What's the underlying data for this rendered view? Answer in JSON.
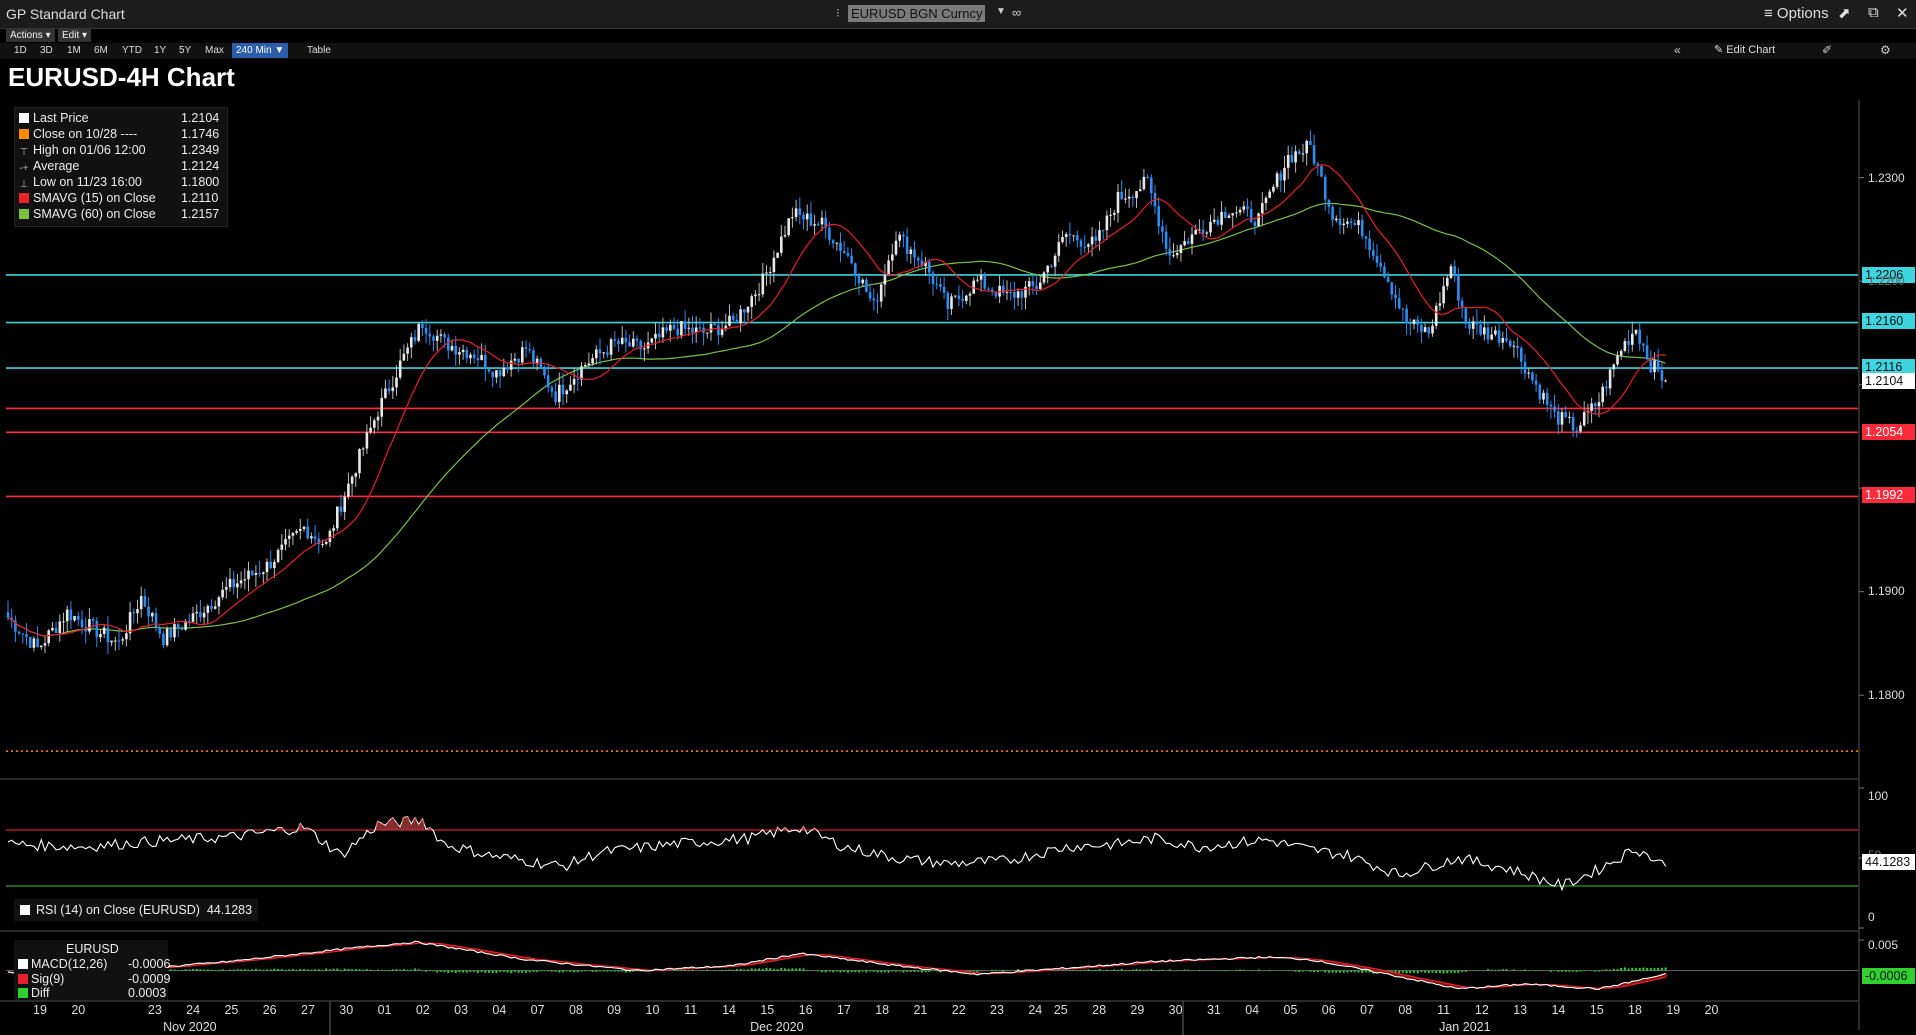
{
  "window": {
    "app_title": "GP Standard Chart",
    "ticker": "EURUSD BGN Curncy",
    "options_label": "Options"
  },
  "toolbar": {
    "actions_label": "Actions ▾",
    "edit_label": "Edit ▾",
    "ranges": [
      "1D",
      "3D",
      "1M",
      "6M",
      "YTD",
      "1Y",
      "5Y",
      "Max"
    ],
    "interval_label": "240 Min ▼",
    "table_label": "Table",
    "edit_chart_label": "Edit Chart"
  },
  "chart_data": {
    "type": "candlestick",
    "title": "EURUSD-4H Chart",
    "legend": [
      {
        "label": "Last Price",
        "value": "1.2104",
        "color": "#ffffff"
      },
      {
        "label": "Close on 10/28 ----",
        "value": "1.1746",
        "color": "#ff8c00"
      },
      {
        "label": "High on 01/06 12:00",
        "value": "1.2349",
        "color": "#aaaaaa"
      },
      {
        "label": "Average",
        "value": "1.2124",
        "color": "#aaaaaa"
      },
      {
        "label": "Low on 11/23 16:00",
        "value": "1.1800",
        "color": "#aaaaaa"
      },
      {
        "label": "SMAVG (15)  on Close",
        "value": "1.2110",
        "color": "#e8202a"
      },
      {
        "label": "SMAVG (60)  on Close",
        "value": "1.2157",
        "color": "#7ac143"
      }
    ],
    "ylim": [
      1.172,
      1.2375
    ],
    "y_ticks": [
      "1.2300",
      "1.2200",
      "1.2100",
      "1.2000",
      "1.1900",
      "1.1800"
    ],
    "last_price_tag": "1.2104",
    "resistance_lines": [
      {
        "value": 1.2206,
        "label": "1.2206",
        "color": "#3dd6e0"
      },
      {
        "value": 1.216,
        "label": "1.2160",
        "color": "#3dd6e0"
      },
      {
        "value": 1.2116,
        "label": "1.2116",
        "color": "#3dd6e0"
      }
    ],
    "support_lines": [
      {
        "value": 1.2077,
        "label": "",
        "color": "#ff2a3a"
      },
      {
        "value": 1.2054,
        "label": "1.2054",
        "color": "#ff2a3a"
      },
      {
        "value": 1.1992,
        "label": "1.1992",
        "color": "#ff2a3a"
      }
    ],
    "reference_close": 1.1746,
    "candle_anchors": [
      {
        "x": 0,
        "close": 1.1875
      },
      {
        "x": 8,
        "close": 1.1845
      },
      {
        "x": 16,
        "close": 1.188
      },
      {
        "x": 24,
        "close": 1.1862
      },
      {
        "x": 30,
        "close": 1.185
      },
      {
        "x": 36,
        "close": 1.1895
      },
      {
        "x": 42,
        "close": 1.1855
      },
      {
        "x": 50,
        "close": 1.1875
      },
      {
        "x": 60,
        "close": 1.1905
      },
      {
        "x": 70,
        "close": 1.1925
      },
      {
        "x": 80,
        "close": 1.1962
      },
      {
        "x": 86,
        "close": 1.1945
      },
      {
        "x": 90,
        "close": 1.1985
      },
      {
        "x": 100,
        "close": 1.2075
      },
      {
        "x": 106,
        "close": 1.212
      },
      {
        "x": 112,
        "close": 1.216
      },
      {
        "x": 118,
        "close": 1.214
      },
      {
        "x": 126,
        "close": 1.213
      },
      {
        "x": 132,
        "close": 1.2112
      },
      {
        "x": 140,
        "close": 1.2135
      },
      {
        "x": 148,
        "close": 1.209
      },
      {
        "x": 156,
        "close": 1.212
      },
      {
        "x": 164,
        "close": 1.214
      },
      {
        "x": 172,
        "close": 1.2135
      },
      {
        "x": 180,
        "close": 1.2155
      },
      {
        "x": 188,
        "close": 1.215
      },
      {
        "x": 196,
        "close": 1.216
      },
      {
        "x": 204,
        "close": 1.22
      },
      {
        "x": 212,
        "close": 1.2265
      },
      {
        "x": 220,
        "close": 1.2255
      },
      {
        "x": 228,
        "close": 1.222
      },
      {
        "x": 234,
        "close": 1.2175
      },
      {
        "x": 240,
        "close": 1.2245
      },
      {
        "x": 248,
        "close": 1.2215
      },
      {
        "x": 254,
        "close": 1.2175
      },
      {
        "x": 262,
        "close": 1.22
      },
      {
        "x": 270,
        "close": 1.2185
      },
      {
        "x": 278,
        "close": 1.2195
      },
      {
        "x": 286,
        "close": 1.2245
      },
      {
        "x": 294,
        "close": 1.2235
      },
      {
        "x": 300,
        "close": 1.228
      },
      {
        "x": 308,
        "close": 1.2295
      },
      {
        "x": 314,
        "close": 1.2225
      },
      {
        "x": 322,
        "close": 1.225
      },
      {
        "x": 330,
        "close": 1.227
      },
      {
        "x": 338,
        "close": 1.226
      },
      {
        "x": 346,
        "close": 1.232
      },
      {
        "x": 352,
        "close": 1.233
      },
      {
        "x": 358,
        "close": 1.2265
      },
      {
        "x": 366,
        "close": 1.225
      },
      {
        "x": 372,
        "close": 1.221
      },
      {
        "x": 378,
        "close": 1.216
      },
      {
        "x": 384,
        "close": 1.215
      },
      {
        "x": 390,
        "close": 1.2215
      },
      {
        "x": 394,
        "close": 1.216
      },
      {
        "x": 400,
        "close": 1.215
      },
      {
        "x": 406,
        "close": 1.2145
      },
      {
        "x": 412,
        "close": 1.2105
      },
      {
        "x": 418,
        "close": 1.207
      },
      {
        "x": 424,
        "close": 1.2058
      },
      {
        "x": 430,
        "close": 1.2085
      },
      {
        "x": 436,
        "close": 1.2135
      },
      {
        "x": 440,
        "close": 1.2155
      },
      {
        "x": 444,
        "close": 1.212
      },
      {
        "x": 448,
        "close": 1.2104
      }
    ],
    "rsi": {
      "label": "RSI (14)  on Close (EURUSD)",
      "value": "44.1283",
      "ylim": [
        0,
        100
      ],
      "levels": [
        70,
        30
      ],
      "y_ticks": [
        "100",
        "50",
        "0"
      ],
      "anchors": [
        {
          "x": 0,
          "v": 60
        },
        {
          "x": 20,
          "v": 58
        },
        {
          "x": 40,
          "v": 62
        },
        {
          "x": 60,
          "v": 65
        },
        {
          "x": 80,
          "v": 72
        },
        {
          "x": 90,
          "v": 52
        },
        {
          "x": 100,
          "v": 74
        },
        {
          "x": 112,
          "v": 77
        },
        {
          "x": 118,
          "v": 60
        },
        {
          "x": 130,
          "v": 52
        },
        {
          "x": 150,
          "v": 44
        },
        {
          "x": 160,
          "v": 54
        },
        {
          "x": 180,
          "v": 60
        },
        {
          "x": 200,
          "v": 64
        },
        {
          "x": 214,
          "v": 72
        },
        {
          "x": 226,
          "v": 58
        },
        {
          "x": 240,
          "v": 50
        },
        {
          "x": 254,
          "v": 46
        },
        {
          "x": 270,
          "v": 48
        },
        {
          "x": 286,
          "v": 58
        },
        {
          "x": 300,
          "v": 60
        },
        {
          "x": 310,
          "v": 64
        },
        {
          "x": 322,
          "v": 58
        },
        {
          "x": 340,
          "v": 63
        },
        {
          "x": 352,
          "v": 56
        },
        {
          "x": 362,
          "v": 52
        },
        {
          "x": 376,
          "v": 38
        },
        {
          "x": 392,
          "v": 50
        },
        {
          "x": 406,
          "v": 42
        },
        {
          "x": 420,
          "v": 30
        },
        {
          "x": 430,
          "v": 42
        },
        {
          "x": 440,
          "v": 57
        },
        {
          "x": 448,
          "v": 44
        }
      ]
    },
    "macd": {
      "title": "EURUSD",
      "legend": [
        {
          "label": "MACD(12,26)",
          "value": "-0.0006",
          "color": "#ffffff"
        },
        {
          "label": "Sig(9)",
          "value": "-0.0009",
          "color": "#e8202a"
        },
        {
          "label": "Diff",
          "value": "0.0003",
          "color": "#30d030"
        }
      ],
      "ylim": [
        -0.0045,
        0.006
      ],
      "y_ticks": [
        "0.005"
      ],
      "last_tag": "-0.0006",
      "anchors": [
        {
          "x": 0,
          "v": -0.0003
        },
        {
          "x": 30,
          "v": 0.0
        },
        {
          "x": 60,
          "v": 0.0015
        },
        {
          "x": 90,
          "v": 0.0035
        },
        {
          "x": 110,
          "v": 0.0047
        },
        {
          "x": 140,
          "v": 0.0018
        },
        {
          "x": 170,
          "v": 0.0
        },
        {
          "x": 196,
          "v": 0.0008
        },
        {
          "x": 214,
          "v": 0.0028
        },
        {
          "x": 240,
          "v": 0.0008
        },
        {
          "x": 262,
          "v": -0.0006
        },
        {
          "x": 286,
          "v": 0.0004
        },
        {
          "x": 310,
          "v": 0.0015
        },
        {
          "x": 340,
          "v": 0.0022
        },
        {
          "x": 352,
          "v": 0.0018
        },
        {
          "x": 372,
          "v": -0.0005
        },
        {
          "x": 392,
          "v": -0.003
        },
        {
          "x": 410,
          "v": -0.0022
        },
        {
          "x": 430,
          "v": -0.003
        },
        {
          "x": 448,
          "v": -0.0006
        }
      ]
    },
    "x_axis": {
      "day_labels": [
        {
          "x": 0,
          "label": "19"
        },
        {
          "x": 6,
          "label": "20"
        },
        {
          "x": 18,
          "label": "23"
        },
        {
          "x": 24,
          "label": "24"
        },
        {
          "x": 30,
          "label": "25"
        },
        {
          "x": 36,
          "label": "26"
        },
        {
          "x": 42,
          "label": "27"
        },
        {
          "x": 48,
          "label": "30"
        },
        {
          "x": 54,
          "label": "01"
        },
        {
          "x": 60,
          "label": "02"
        },
        {
          "x": 66,
          "label": "03"
        },
        {
          "x": 72,
          "label": "04"
        },
        {
          "x": 78,
          "label": "07"
        },
        {
          "x": 84,
          "label": "08"
        },
        {
          "x": 90,
          "label": "09"
        },
        {
          "x": 96,
          "label": "10"
        },
        {
          "x": 102,
          "label": "11"
        },
        {
          "x": 108,
          "label": "14"
        },
        {
          "x": 114,
          "label": "15"
        },
        {
          "x": 120,
          "label": "16"
        },
        {
          "x": 126,
          "label": "17"
        },
        {
          "x": 132,
          "label": "18"
        },
        {
          "x": 138,
          "label": "21"
        },
        {
          "x": 144,
          "label": "22"
        },
        {
          "x": 150,
          "label": "23"
        },
        {
          "x": 156,
          "label": "24"
        },
        {
          "x": 160,
          "label": "25"
        },
        {
          "x": 166,
          "label": "28"
        },
        {
          "x": 172,
          "label": "29"
        },
        {
          "x": 178,
          "label": "30"
        },
        {
          "x": 184,
          "label": "31"
        },
        {
          "x": 190,
          "label": "04"
        },
        {
          "x": 196,
          "label": "05"
        },
        {
          "x": 202,
          "label": "06"
        },
        {
          "x": 208,
          "label": "07"
        },
        {
          "x": 214,
          "label": "08"
        },
        {
          "x": 220,
          "label": "11"
        },
        {
          "x": 226,
          "label": "12"
        },
        {
          "x": 232,
          "label": "13"
        },
        {
          "x": 238,
          "label": "14"
        },
        {
          "x": 244,
          "label": "15"
        },
        {
          "x": 250,
          "label": "18"
        },
        {
          "x": 256,
          "label": "19"
        },
        {
          "x": 262,
          "label": "20"
        }
      ],
      "months": [
        {
          "x": 24,
          "label": "Nov 2020"
        },
        {
          "x": 116,
          "label": "Dec 2020"
        },
        {
          "x": 224,
          "label": "Jan 2021"
        }
      ]
    }
  }
}
